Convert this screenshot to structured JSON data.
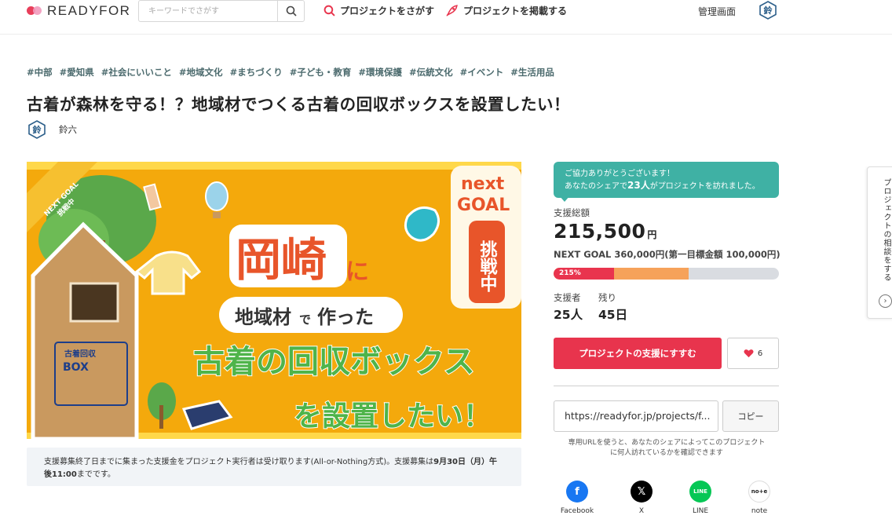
{
  "header": {
    "logo_text": "READYFOR",
    "search_placeholder": "キーワードでさがす",
    "nav_find": "プロジェクトをさがす",
    "nav_post": "プロジェクトを掲載する",
    "admin": "管理画面",
    "avatar_char": "鈴"
  },
  "tags": [
    "#中部",
    "#愛知県",
    "#社会にいいこと",
    "#地域文化",
    "#まちづくり",
    "#子ども・教育",
    "#環境保護",
    "#伝統文化",
    "#イベント",
    "#生活用品"
  ],
  "project": {
    "title": "古着が森林を守る！？地域材でつくる古着の回収ボックスを設置したい！",
    "owner_name": "鈴六",
    "owner_avatar_char": "鈴"
  },
  "hero": {
    "ribbon_line1": "NEXT GOAL",
    "ribbon_line2": "挑戦中",
    "badge_line1": "next",
    "badge_line2": "GOAL",
    "badge_line3": "挑戦中",
    "headline_city": "岡崎",
    "headline_particle": "に",
    "sub1_a": "地域材",
    "sub1_b": "で",
    "sub1_c": "作った",
    "main_line": "古着の回収ボックス",
    "last_line": "を設置したい！",
    "box_label1": "古着回収",
    "box_label2": "BOX"
  },
  "notice": {
    "text_before": "支援募集終了日までに集まった支援金をプロジェクト実行者は受け取ります(All-or-Nothing方式)。支援募集は",
    "bold_date": "9月30日（月）午後11:00",
    "text_after": "までです。"
  },
  "share_message": {
    "line1": "ご協力ありがとうございます！",
    "line2_before": "あなたのシェアで",
    "count": "23人",
    "line2_after": "がプロジェクトを訪れました。"
  },
  "funding": {
    "total_label": "支援総額",
    "amount": "215,500",
    "unit": "円",
    "next_goal_text": "NEXT GOAL 360,000円(第一目標金額 100,000円)",
    "progress_label": "215%",
    "progress_first_fraction": 0.27,
    "progress_next_fraction": 0.6,
    "supporters_label": "支援者",
    "supporters_value": "25人",
    "remaining_label": "残り",
    "remaining_value": "45日"
  },
  "actions": {
    "support_button": "プロジェクトの支援にすすむ",
    "favorite_count": "6",
    "share_url": "https://readyfor.jp/projects/f...",
    "copy_button": "コピー",
    "url_help": "専用URLを使うと、あなたのシェアによってこのプロジェクトに何人訪れているかを確認できます"
  },
  "share_buttons": [
    {
      "label": "Facebook",
      "icon": "facebook-icon",
      "color": "#1877f2"
    },
    {
      "label": "X",
      "icon": "x-icon",
      "color": "#000000"
    },
    {
      "label": "LINE",
      "icon": "line-icon",
      "color": "#06c755"
    },
    {
      "label": "note",
      "icon": "note-icon",
      "color": "#ffffff"
    }
  ],
  "side_tab": {
    "text": "プロジェクトの相談をする"
  },
  "colors": {
    "accent_red": "#e8344d",
    "teal": "#3fb1a4",
    "tag_color": "#4b6a6d",
    "hero_orange": "#f4a90c"
  }
}
